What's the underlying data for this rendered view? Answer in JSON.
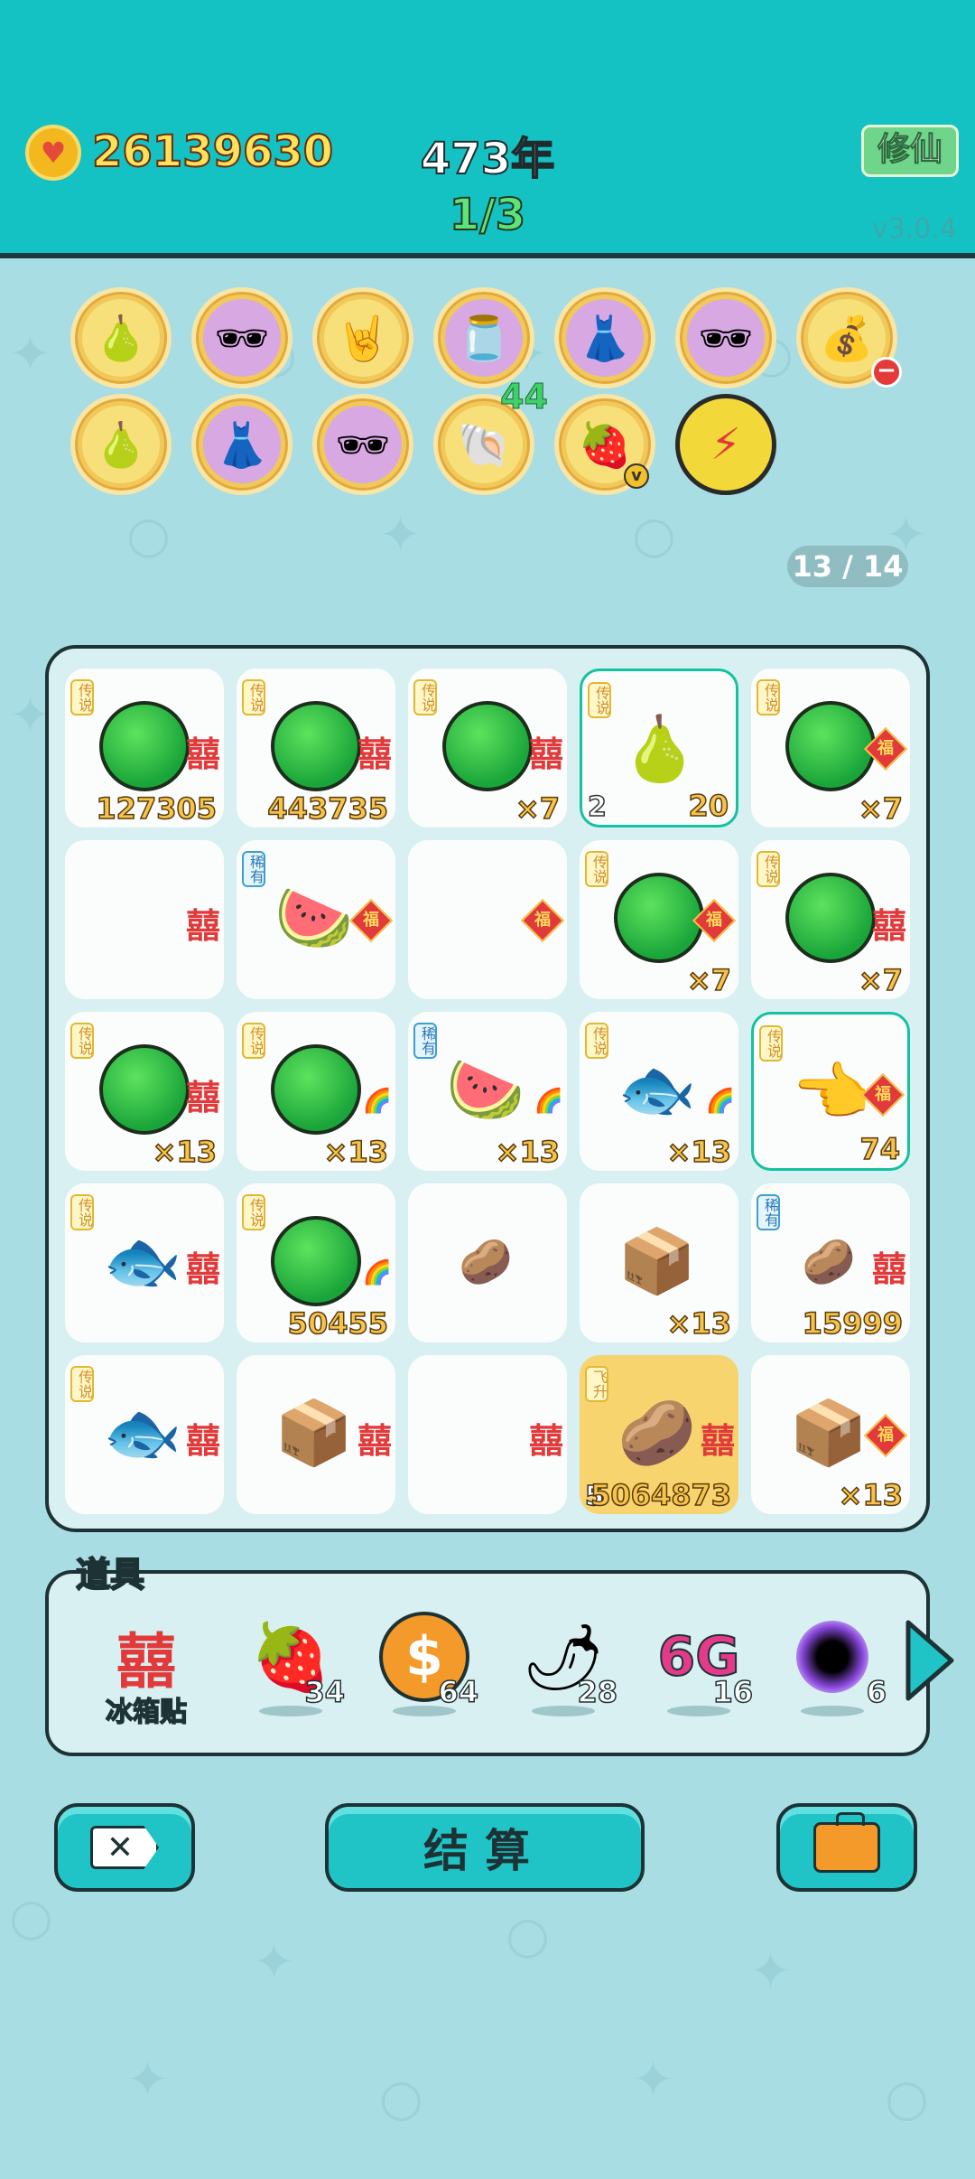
{
  "header": {
    "coins": "26139630",
    "year": "473年",
    "progress": "1/3",
    "xiuxian_label": "修仙",
    "version": "v3.0.4"
  },
  "status_icons_row1": [
    {
      "name": "pomelo-icon",
      "glyph": "🍐",
      "style": "yellow"
    },
    {
      "name": "sunglasses-orange-icon",
      "glyph": "🕶",
      "style": "purple"
    },
    {
      "name": "rock-hand-icon",
      "glyph": "🤘",
      "style": "yellow"
    },
    {
      "name": "jar-icon",
      "glyph": "🫙",
      "style": "purple"
    },
    {
      "name": "skirt-icon",
      "glyph": "👗",
      "style": "purple"
    },
    {
      "name": "sunglasses-orange-icon",
      "glyph": "🕶",
      "style": "purple"
    },
    {
      "name": "bag-icon",
      "glyph": "💰",
      "style": "yellow",
      "minus": true
    }
  ],
  "status_icons_row2": [
    {
      "name": "pomelo-icon",
      "glyph": "🍐",
      "style": "yellow"
    },
    {
      "name": "skirt-icon",
      "glyph": "👗",
      "style": "purple"
    },
    {
      "name": "sunglasses-orange-icon",
      "glyph": "🕶",
      "style": "purple"
    },
    {
      "name": "shell-icon",
      "glyph": "🐚",
      "style": "yellow",
      "badge": "44"
    },
    {
      "name": "fruit-bowl-icon",
      "glyph": "🍓",
      "style": "yellow",
      "v": true
    },
    {
      "name": "lightning-icon",
      "glyph": "⚡",
      "style": "lightning"
    }
  ],
  "page_count": "13 / 14",
  "grid_numbers": {
    "r0c0": "127305",
    "r0c1": "443735",
    "r0c2": "×7",
    "r0c3_left": "2",
    "r0c3": "20",
    "r0c4": "×7",
    "r1c3": "×7",
    "r1c4": "×7",
    "r2c0": "×13",
    "r2c1": "×13",
    "r2c2": "×13",
    "r2c3": "×13",
    "r2c4": "74",
    "r3c1": "50455",
    "r3c3": "×13",
    "r3c4": "15999",
    "r4c3_left": "5",
    "r4c3": "5064873",
    "r4c4": "×13"
  },
  "tags": {
    "legend": "传说",
    "rare": "稀有",
    "fly": "飞升"
  },
  "marks": {
    "xi": "囍",
    "fu": "福"
  },
  "props": {
    "title": "道具",
    "items": [
      {
        "name": "fridge-sticker",
        "label": "冰箱贴",
        "count": ""
      },
      {
        "name": "lychee",
        "count": "34"
      },
      {
        "name": "coin",
        "count": "64"
      },
      {
        "name": "chili",
        "count": "28"
      },
      {
        "name": "6g",
        "count": "16",
        "text": "6G"
      },
      {
        "name": "black-hole",
        "count": "6"
      }
    ]
  },
  "buttons": {
    "settle": "结算"
  }
}
